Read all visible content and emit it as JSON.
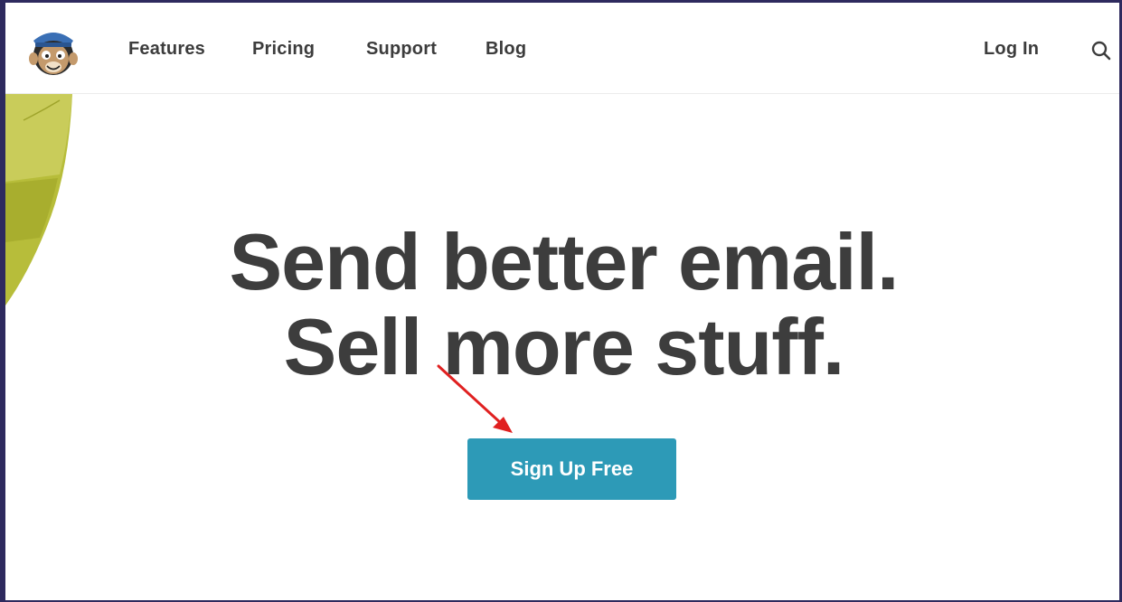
{
  "nav": {
    "logo_icon": "mailchimp-monkey-logo",
    "links": {
      "features": "Features",
      "pricing": "Pricing",
      "support": "Support",
      "blog": "Blog"
    },
    "login": "Log In",
    "search_icon": "search-icon"
  },
  "hero": {
    "line1": "Send better email.",
    "line2": "Sell more stuff.",
    "cta": "Sign Up Free"
  },
  "annotation": {
    "type": "arrow",
    "color": "#e02020"
  },
  "colors": {
    "cta_background": "#2d9ab7",
    "headline": "#3d3d3d",
    "nav_text": "#3c3c3c",
    "decoration": "#b7bd3a",
    "frame_border": "#2e2a5e"
  }
}
